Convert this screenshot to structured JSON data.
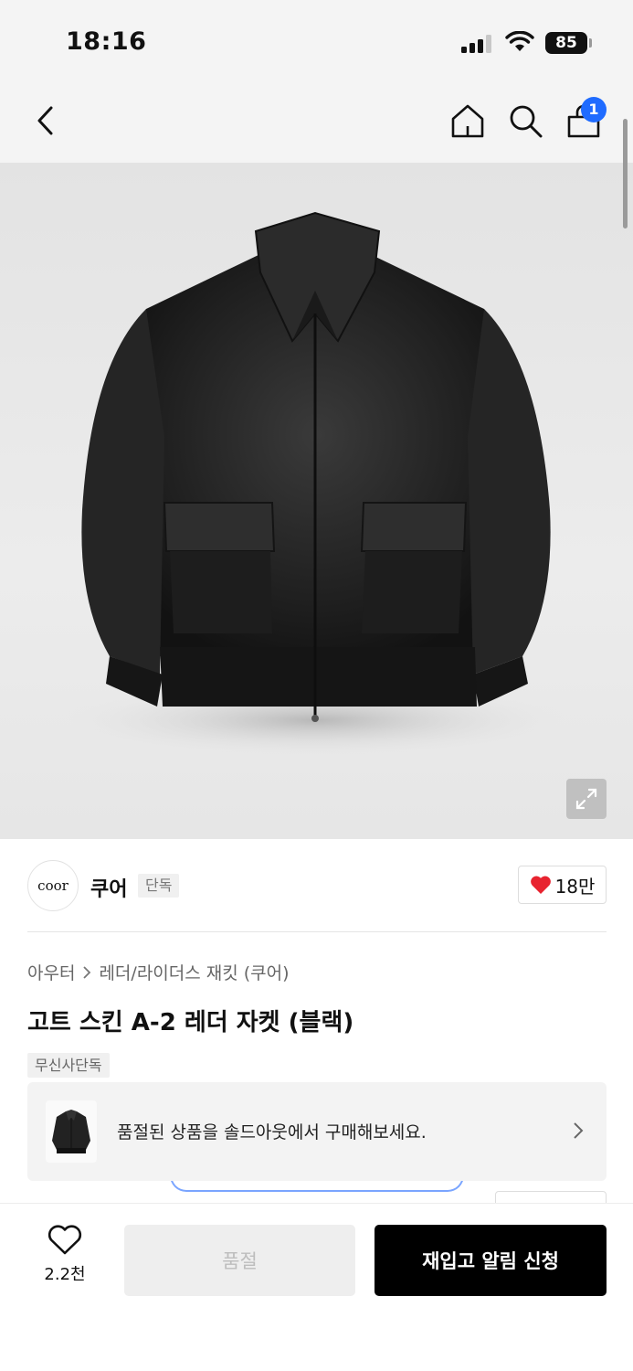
{
  "status_bar": {
    "time": "18:16",
    "battery": "85"
  },
  "nav": {
    "cart_count": "1",
    "icons": [
      "back-icon",
      "home-icon",
      "search-icon",
      "shopping-bag-icon"
    ]
  },
  "brand": {
    "logo_text": "coor",
    "name": "쿠어",
    "tag": "단독",
    "likes": "18만"
  },
  "breadcrumb": {
    "category": "아우터",
    "subcategory": "레더/라이더스 재킷 (쿠어)"
  },
  "product": {
    "title": "고트 스킨 A-2 레더 자켓 (블랙)",
    "tag": "무신사단독"
  },
  "banner": {
    "text": "품절된 상품을 솔드아웃에서 구매해보세요."
  },
  "bottom_bar": {
    "wish_count": "2.2천",
    "soldout_label": "품절",
    "restock_label": "재입고 알림 신청"
  },
  "colors": {
    "accent_blue": "#1f6bff",
    "heart_red": "#e8232f",
    "primary_button": "#000000"
  }
}
